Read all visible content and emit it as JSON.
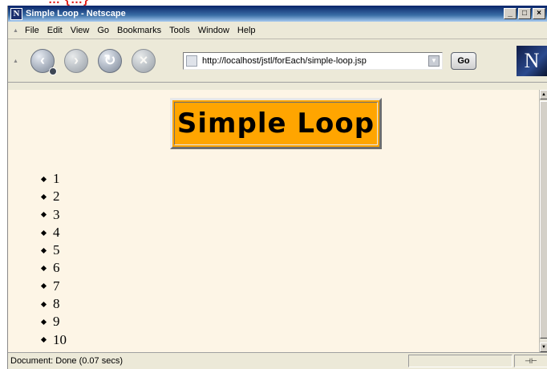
{
  "window": {
    "title": "Simple Loop - Netscape",
    "app_icon_letter": "N",
    "minimize": "_",
    "maximize": "□",
    "close": "×"
  },
  "menu": [
    "File",
    "Edit",
    "View",
    "Go",
    "Bookmarks",
    "Tools",
    "Window",
    "Help"
  ],
  "toolbar": {
    "back_icon": "back-arrow-icon",
    "forward_icon": "forward-arrow-icon",
    "reload_icon": "reload-icon",
    "stop_icon": "stop-icon",
    "url": "http://localhost/jstl/forEach/simple-loop.jsp",
    "go_label": "Go",
    "logo_letter": "N"
  },
  "page": {
    "heading": "Simple Loop",
    "heading_bg": "#ffa500",
    "page_bg": "#fdf5e6",
    "items": [
      "1",
      "2",
      "3",
      "4",
      "5",
      "6",
      "7",
      "8",
      "9",
      "10"
    ]
  },
  "status": {
    "text": "Document: Done (0.07 secs)"
  }
}
